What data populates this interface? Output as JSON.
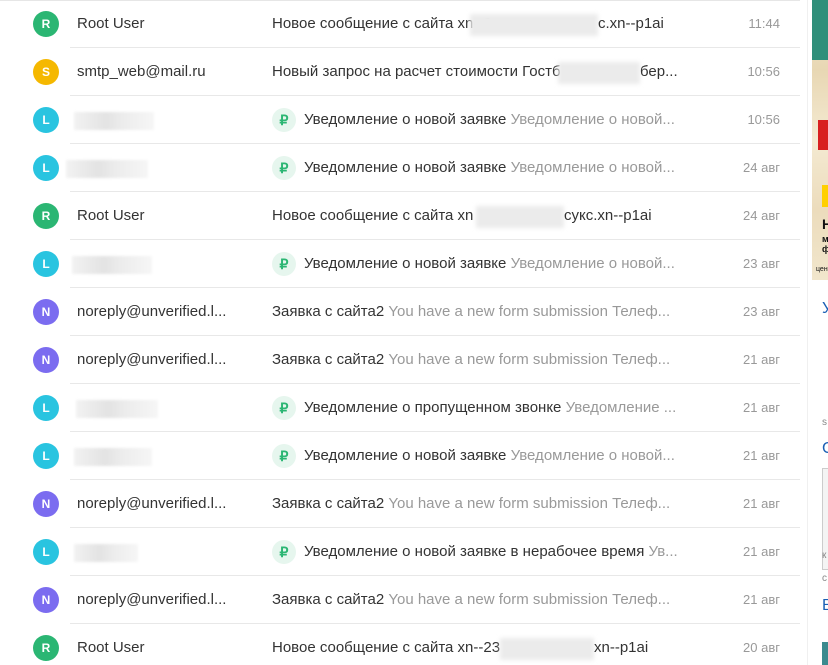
{
  "mail": {
    "rows": [
      {
        "avatar_letter": "R",
        "avatar_color": "#2bb673",
        "sender": "Root User",
        "icon": "",
        "subject": "Новое сообщение с сайта xn--2",
        "subject_tail": "с.xn--p1ai",
        "preview": "",
        "date": "11:44"
      },
      {
        "avatar_letter": "S",
        "avatar_color": "#f5b800",
        "sender": "smtp_web@mail.ru",
        "icon": "",
        "subject": "Новый запрос на расчет стоимости Гостб",
        "subject_tail": "бер...",
        "preview": "",
        "date": "10:56"
      },
      {
        "avatar_letter": "L",
        "avatar_color": "#29c4e0",
        "sender": "",
        "icon": "ruble-icon",
        "subject": "Уведомление о новой заявке",
        "subject_tail": "",
        "preview": "Уведомление о новой...",
        "date": "10:56"
      },
      {
        "avatar_letter": "L",
        "avatar_color": "#29c4e0",
        "sender": "",
        "icon": "ruble-icon",
        "subject": "Уведомление о новой заявке",
        "subject_tail": "",
        "preview": "Уведомление о новой...",
        "date": "24 авг"
      },
      {
        "avatar_letter": "R",
        "avatar_color": "#2bb673",
        "sender": "Root User",
        "icon": "",
        "subject": "Новое сообщение с сайта xn",
        "subject_tail": "сукс.xn--p1ai",
        "preview": "",
        "date": "24 авг"
      },
      {
        "avatar_letter": "L",
        "avatar_color": "#29c4e0",
        "sender": "",
        "icon": "ruble-icon",
        "subject": "Уведомление о новой заявке",
        "subject_tail": "",
        "preview": "Уведомление о новой...",
        "date": "23 авг"
      },
      {
        "avatar_letter": "N",
        "avatar_color": "#7b6cf0",
        "sender": "noreply@unverified.l...",
        "icon": "",
        "subject": "Заявка с сайта2",
        "subject_tail": "",
        "preview": "You have a new form submission Телеф...",
        "date": "23 авг"
      },
      {
        "avatar_letter": "N",
        "avatar_color": "#7b6cf0",
        "sender": "noreply@unverified.l...",
        "icon": "",
        "subject": "Заявка с сайта2",
        "subject_tail": "",
        "preview": "You have a new form submission Телеф...",
        "date": "21 авг"
      },
      {
        "avatar_letter": "L",
        "avatar_color": "#29c4e0",
        "sender": "",
        "icon": "ruble-icon",
        "subject": "Уведомление о пропущенном звонке",
        "subject_tail": "",
        "preview": "Уведомление ...",
        "date": "21 авг"
      },
      {
        "avatar_letter": "L",
        "avatar_color": "#29c4e0",
        "sender": "",
        "icon": "ruble-icon",
        "subject": "Уведомление о новой заявке",
        "subject_tail": "",
        "preview": "Уведомление о новой...",
        "date": "21 авг"
      },
      {
        "avatar_letter": "N",
        "avatar_color": "#7b6cf0",
        "sender": "noreply@unverified.l...",
        "icon": "",
        "subject": "Заявка с сайта2",
        "subject_tail": "",
        "preview": "You have a new form submission Телеф...",
        "date": "21 авг"
      },
      {
        "avatar_letter": "L",
        "avatar_color": "#29c4e0",
        "sender": "",
        "icon": "ruble-icon",
        "subject": "Уведомление о новой заявке в нерабочее время",
        "subject_tail": "",
        "preview": "Ув...",
        "date": "21 авг"
      },
      {
        "avatar_letter": "N",
        "avatar_color": "#7b6cf0",
        "sender": "noreply@unverified.l...",
        "icon": "",
        "subject": "Заявка с сайта2",
        "subject_tail": "",
        "preview": "You have a new form submission Телеф...",
        "date": "21 авг"
      },
      {
        "avatar_letter": "R",
        "avatar_color": "#2bb673",
        "sender": "Root User",
        "icon": "",
        "subject": "Новое сообщение с сайта xn--23",
        "subject_tail": "xn--p1ai",
        "preview": "",
        "date": "20 авг"
      }
    ],
    "ruble_glyph": "₽"
  },
  "side": {
    "ad_letters": [
      "Н",
      "м",
      "ф",
      "цен"
    ],
    "link_letters": [
      "У",
      "С",
      "В"
    ],
    "small_letters": [
      "s",
      "к",
      "с"
    ]
  }
}
